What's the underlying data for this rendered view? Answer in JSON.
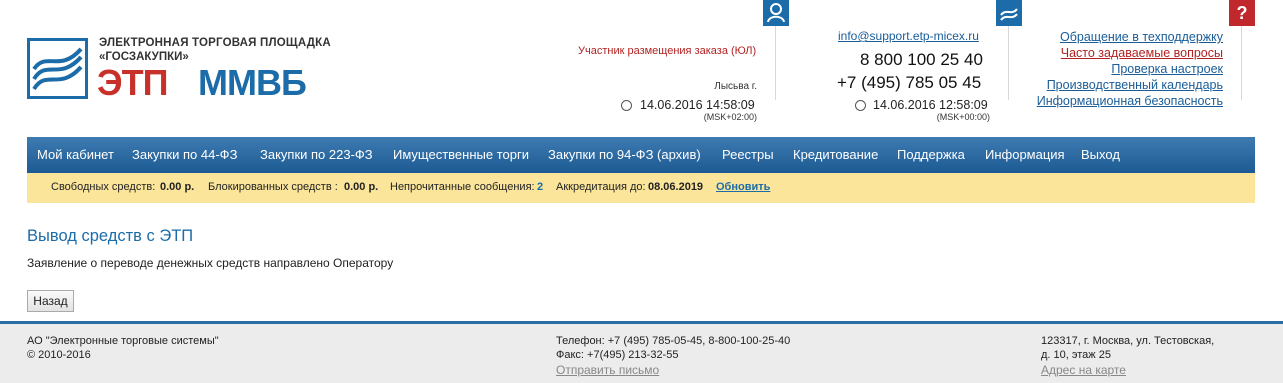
{
  "logo": {
    "line1": "ЭЛЕКТРОННАЯ ТОРГОВАЯ ПЛОЩАДКА",
    "line2": "«ГОСЗАКУПКИ»",
    "big1": "ЭТП",
    "big2": "ММВБ"
  },
  "user": {
    "role": "Участник размещения заказа (ЮЛ)",
    "city": "Лысьва г.",
    "datetime": "14.06.2016 14:58:09",
    "tz": "(MSK+02:00)"
  },
  "support": {
    "email": "info@support.etp-micex.ru",
    "phone1": "8 800 100 25 40",
    "phone2": "+7 (495) 785 05 45",
    "datetime": "14.06.2016 12:58:09",
    "tz": "(MSK+00:00)"
  },
  "help_links": [
    "Обращение в техподдержку",
    "Часто задаваемые вопросы",
    "Проверка настроек",
    "Производственный календарь",
    "Информационная безопасность"
  ],
  "menu": [
    "Мой кабинет",
    "Закупки по 44-ФЗ",
    "Закупки по 223-ФЗ",
    "Имущественные торги",
    "Закупки по 94-ФЗ (архив)",
    "Реестры",
    "Кредитование",
    "Поддержка",
    "Информация",
    "Выход"
  ],
  "infobar": {
    "free_label": "Свободных средств:",
    "free_value": "0.00 р.",
    "blocked_label": "Блокированных средств :",
    "blocked_value": "0.00 р.",
    "unread_label": "Непрочитанные сообщения:",
    "unread_value": "2",
    "accr_label": "Аккредитация до:",
    "accr_value": "08.06.2019",
    "refresh": "Обновить"
  },
  "page": {
    "title": "Вывод средств с ЭТП",
    "message": "Заявление о переводе денежных средств направлено Оператору",
    "back": "Назад"
  },
  "footer": {
    "company": "АО \"Электронные торговые системы\"",
    "copyright": "© 2010-2016",
    "phone": "Телефон: +7 (495) 785-05-45, 8-800-100-25-40",
    "fax": "Факс: +7(495) 213-32-55",
    "mail_link": "Отправить письмо",
    "address1": "123317, г. Москва, ул. Тестовская,",
    "address2": "д. 10, этаж 25",
    "map_link": "Адрес на карте"
  },
  "colors": {
    "brand_blue": "#1b6ca8",
    "brand_red": "#c8302a",
    "menu_bg": "#2a679f",
    "infobar_bg": "#fbe59b"
  },
  "icons": [
    "user-icon",
    "support-logo-icon",
    "help-icon",
    "clock-icon"
  ]
}
